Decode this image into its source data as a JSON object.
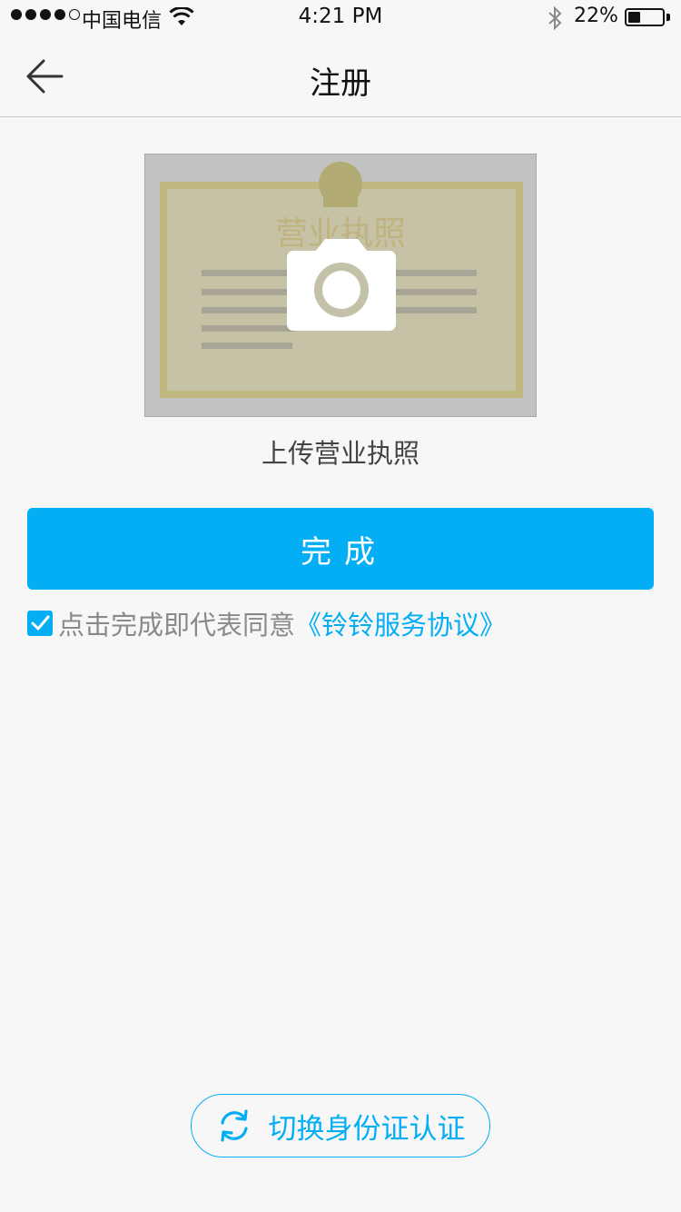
{
  "status_bar": {
    "carrier": "中国电信",
    "time": "4:21 PM",
    "battery": "22%",
    "battery_level": 0.22,
    "signal_bars": 4
  },
  "nav": {
    "title": "注册",
    "back_icon": "arrow-left-icon"
  },
  "upload": {
    "license_heading": "营业执照",
    "camera_icon": "camera-icon",
    "caption": "上传营业执照"
  },
  "actions": {
    "done_label": "完成"
  },
  "agreement": {
    "checked": true,
    "text": "点击完成即代表同意",
    "link": "《铃铃服务协议》"
  },
  "footer": {
    "switch_label": "切换身份证认证",
    "switch_icon": "refresh-icon"
  },
  "colors": {
    "accent": "#03aef5",
    "background": "#f7f7f7"
  }
}
